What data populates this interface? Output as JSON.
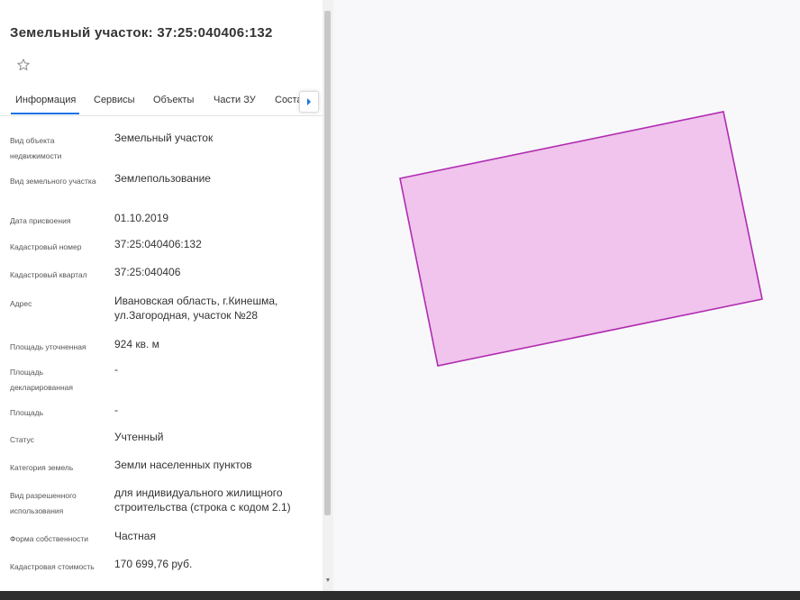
{
  "title": "Земельный участок: 37:25:040406:132",
  "favorite": {
    "icon": "star-outline-icon"
  },
  "tabs": [
    {
      "label": "Информация",
      "active": true
    },
    {
      "label": "Сервисы",
      "active": false
    },
    {
      "label": "Объекты",
      "active": false
    },
    {
      "label": "Части ЗУ",
      "active": false
    },
    {
      "label": "Соста",
      "active": false
    }
  ],
  "tabs_more": {
    "icon": "chevron-right-icon"
  },
  "fields": [
    {
      "label": "Вид объекта недвижимости",
      "value": "Земельный участок"
    },
    {
      "label": "Вид земельного участка",
      "value": "Землепользование"
    },
    {
      "label": "Дата присвоения",
      "value": "01.10.2019"
    },
    {
      "label": "Кадастровый номер",
      "value": "37:25:040406:132"
    },
    {
      "label": "Кадастровый квартал",
      "value": "37:25:040406"
    },
    {
      "label": "Адрес",
      "value": "Ивановская область, г.Кинешма, ул.Загородная, участок №28"
    },
    {
      "label": "Площадь уточненная",
      "value": "924 кв. м"
    },
    {
      "label": "Площадь декларированная",
      "value": "-"
    },
    {
      "label": "Площадь",
      "value": "-"
    },
    {
      "label": "Статус",
      "value": "Учтенный"
    },
    {
      "label": "Категория земель",
      "value": "Земли населенных пунктов"
    },
    {
      "label": "Вид разрешенного использования",
      "value": "для индивидуального жилищного строительства (строка с кодом 2.1)"
    },
    {
      "label": "Форма собственности",
      "value": "Частная"
    },
    {
      "label": "Кадастровая стоимость",
      "value": "170 699,76 руб."
    }
  ],
  "map": {
    "parcel_fill": "#f0c4ec",
    "parcel_stroke": "#b02cb0"
  },
  "colors": {
    "accent": "#1a73e8",
    "panel_bg": "#ffffff",
    "map_bg": "#f8f8fb"
  }
}
